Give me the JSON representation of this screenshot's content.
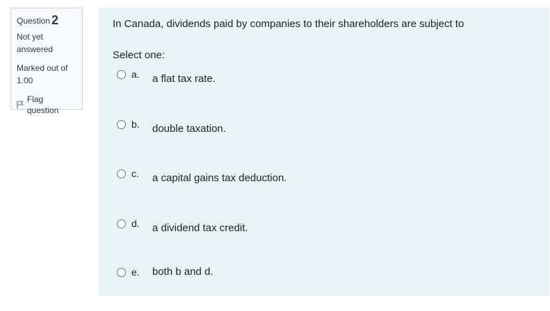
{
  "info": {
    "question_label": "Question",
    "question_number": "2",
    "state": "Not yet answered",
    "grade_line1": "Marked out of",
    "grade_line2": "1.00",
    "flag_label": "Flag question"
  },
  "question": {
    "text": "In Canada, dividends paid by companies to their shareholders are subject to",
    "prompt": "Select one:",
    "options": [
      {
        "letter": "a.",
        "text": "a flat tax rate."
      },
      {
        "letter": "b.",
        "text": "double taxation."
      },
      {
        "letter": "c.",
        "text": "a capital gains tax deduction."
      },
      {
        "letter": "d.",
        "text": "a dividend tax credit."
      },
      {
        "letter": "e.",
        "text": "both b and d."
      }
    ]
  }
}
